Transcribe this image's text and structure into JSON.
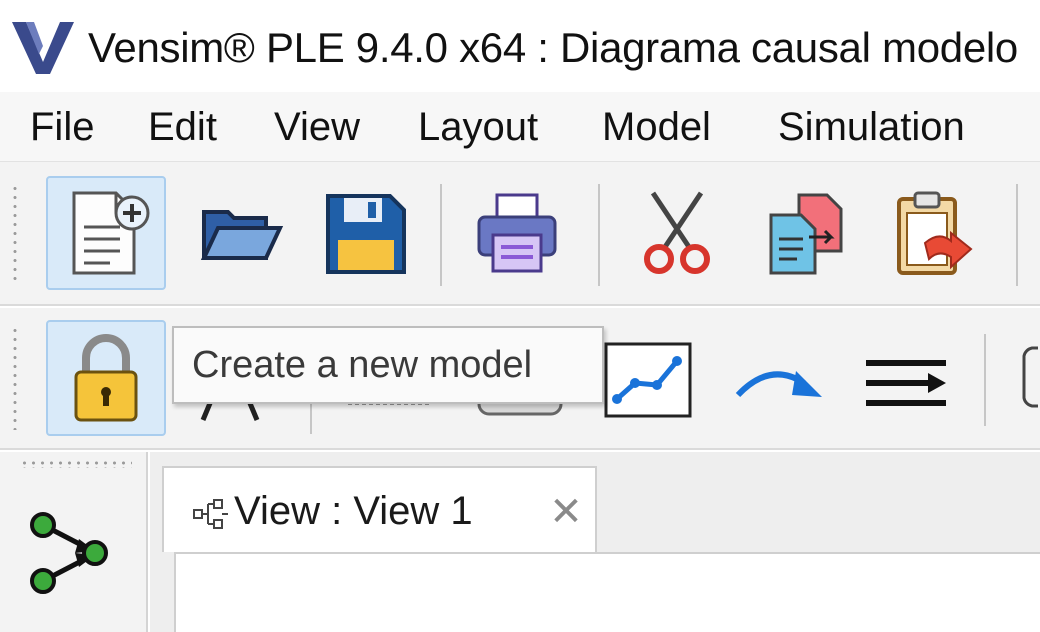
{
  "window": {
    "title": "Vensim® PLE 9.4.0 x64 : Diagrama causal modelo",
    "logo_icon": "vensim-logo-icon"
  },
  "menu": {
    "items": [
      "File",
      "Edit",
      "View",
      "Layout",
      "Model",
      "Simulation"
    ]
  },
  "toolbar1": {
    "buttons": [
      "new-model-icon",
      "open-icon",
      "save-icon",
      "print-icon",
      "cut-icon",
      "copy-icon",
      "paste-icon"
    ]
  },
  "toolbar2": {
    "buttons": [
      "lock-icon",
      "variable-icon",
      "box-variable-icon",
      "graph-lookup-icon",
      "arrow-icon",
      "rate-icon"
    ]
  },
  "tooltip": {
    "text": "Create a new model"
  },
  "view_tab": {
    "label": "View : View 1",
    "close": "✕"
  },
  "colors": {
    "logo_blue": "#3a4a8c",
    "folder_blue": "#2f5fa6",
    "save_blue": "#1f5fa8",
    "save_yellow": "#f6c340",
    "scissor_red": "#d7352c",
    "link_blue": "#1a73d9",
    "active_bg": "#d9eaf9",
    "node_green": "#3caa3c"
  }
}
